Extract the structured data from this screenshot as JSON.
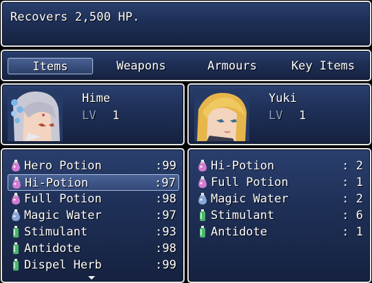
{
  "help": {
    "text": "Recovers 2,500 HP."
  },
  "categories": [
    {
      "label": "Items"
    },
    {
      "label": "Weapons"
    },
    {
      "label": "Armours"
    },
    {
      "label": "Key Items"
    }
  ],
  "selected_category": "Items",
  "actors": [
    {
      "name": "Hime",
      "lv_label": "LV",
      "level": "1",
      "face": "hime-face"
    },
    {
      "name": "Yuki",
      "lv_label": "LV",
      "level": "1",
      "face": "yuki-face"
    }
  ],
  "inventory_left": [
    {
      "name": "Hero Potion",
      "qty": ":99",
      "icon": "pink-potion-icon"
    },
    {
      "name": "Hi-Potion",
      "qty": ":97",
      "icon": "pink-potion-icon"
    },
    {
      "name": "Full Potion",
      "qty": ":98",
      "icon": "pink-potion-icon"
    },
    {
      "name": "Magic Water",
      "qty": ":97",
      "icon": "blue-potion-icon"
    },
    {
      "name": "Stimulant",
      "qty": ":93",
      "icon": "green-potion-icon"
    },
    {
      "name": "Antidote",
      "qty": ":98",
      "icon": "green-potion-icon"
    },
    {
      "name": "Dispel Herb",
      "qty": ":99",
      "icon": "green-potion-icon"
    }
  ],
  "selected_left_item": "Hi-Potion",
  "inventory_right": [
    {
      "name": "Hi-Potion",
      "qty": ": 2",
      "icon": "pink-potion-icon"
    },
    {
      "name": "Full Potion",
      "qty": ": 1",
      "icon": "pink-potion-icon"
    },
    {
      "name": "Magic Water",
      "qty": ": 2",
      "icon": "blue-potion-icon"
    },
    {
      "name": "Stimulant",
      "qty": ": 6",
      "icon": "green-potion-icon"
    },
    {
      "name": "Antidote",
      "qty": ": 1",
      "icon": "green-potion-icon"
    }
  ],
  "colors": {
    "window_top": "#2a3f6e",
    "window_bottom": "#15213f",
    "border": "#e8e8e8",
    "lv_label": "#8ea2c8",
    "pink_potion": "#d27bd1",
    "blue_potion": "#89a6d6",
    "green_potion": "#4db36b"
  }
}
